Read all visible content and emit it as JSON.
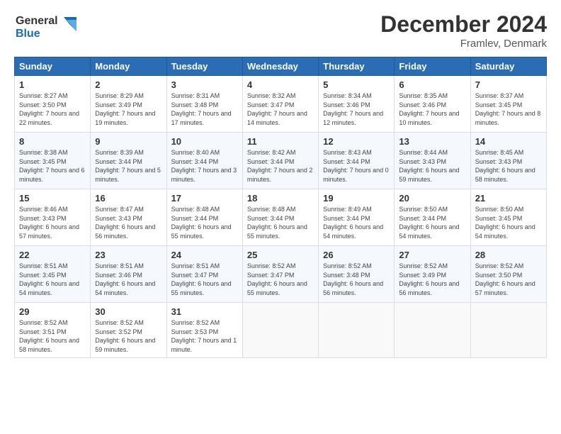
{
  "header": {
    "logo_line1": "General",
    "logo_line2": "Blue",
    "month_title": "December 2024",
    "location": "Framlev, Denmark"
  },
  "weekdays": [
    "Sunday",
    "Monday",
    "Tuesday",
    "Wednesday",
    "Thursday",
    "Friday",
    "Saturday"
  ],
  "weeks": [
    [
      {
        "day": "1",
        "sunrise": "Sunrise: 8:27 AM",
        "sunset": "Sunset: 3:50 PM",
        "daylight": "Daylight: 7 hours and 22 minutes."
      },
      {
        "day": "2",
        "sunrise": "Sunrise: 8:29 AM",
        "sunset": "Sunset: 3:49 PM",
        "daylight": "Daylight: 7 hours and 19 minutes."
      },
      {
        "day": "3",
        "sunrise": "Sunrise: 8:31 AM",
        "sunset": "Sunset: 3:48 PM",
        "daylight": "Daylight: 7 hours and 17 minutes."
      },
      {
        "day": "4",
        "sunrise": "Sunrise: 8:32 AM",
        "sunset": "Sunset: 3:47 PM",
        "daylight": "Daylight: 7 hours and 14 minutes."
      },
      {
        "day": "5",
        "sunrise": "Sunrise: 8:34 AM",
        "sunset": "Sunset: 3:46 PM",
        "daylight": "Daylight: 7 hours and 12 minutes."
      },
      {
        "day": "6",
        "sunrise": "Sunrise: 8:35 AM",
        "sunset": "Sunset: 3:46 PM",
        "daylight": "Daylight: 7 hours and 10 minutes."
      },
      {
        "day": "7",
        "sunrise": "Sunrise: 8:37 AM",
        "sunset": "Sunset: 3:45 PM",
        "daylight": "Daylight: 7 hours and 8 minutes."
      }
    ],
    [
      {
        "day": "8",
        "sunrise": "Sunrise: 8:38 AM",
        "sunset": "Sunset: 3:45 PM",
        "daylight": "Daylight: 7 hours and 6 minutes."
      },
      {
        "day": "9",
        "sunrise": "Sunrise: 8:39 AM",
        "sunset": "Sunset: 3:44 PM",
        "daylight": "Daylight: 7 hours and 5 minutes."
      },
      {
        "day": "10",
        "sunrise": "Sunrise: 8:40 AM",
        "sunset": "Sunset: 3:44 PM",
        "daylight": "Daylight: 7 hours and 3 minutes."
      },
      {
        "day": "11",
        "sunrise": "Sunrise: 8:42 AM",
        "sunset": "Sunset: 3:44 PM",
        "daylight": "Daylight: 7 hours and 2 minutes."
      },
      {
        "day": "12",
        "sunrise": "Sunrise: 8:43 AM",
        "sunset": "Sunset: 3:44 PM",
        "daylight": "Daylight: 7 hours and 0 minutes."
      },
      {
        "day": "13",
        "sunrise": "Sunrise: 8:44 AM",
        "sunset": "Sunset: 3:43 PM",
        "daylight": "Daylight: 6 hours and 59 minutes."
      },
      {
        "day": "14",
        "sunrise": "Sunrise: 8:45 AM",
        "sunset": "Sunset: 3:43 PM",
        "daylight": "Daylight: 6 hours and 58 minutes."
      }
    ],
    [
      {
        "day": "15",
        "sunrise": "Sunrise: 8:46 AM",
        "sunset": "Sunset: 3:43 PM",
        "daylight": "Daylight: 6 hours and 57 minutes."
      },
      {
        "day": "16",
        "sunrise": "Sunrise: 8:47 AM",
        "sunset": "Sunset: 3:43 PM",
        "daylight": "Daylight: 6 hours and 56 minutes."
      },
      {
        "day": "17",
        "sunrise": "Sunrise: 8:48 AM",
        "sunset": "Sunset: 3:44 PM",
        "daylight": "Daylight: 6 hours and 55 minutes."
      },
      {
        "day": "18",
        "sunrise": "Sunrise: 8:48 AM",
        "sunset": "Sunset: 3:44 PM",
        "daylight": "Daylight: 6 hours and 55 minutes."
      },
      {
        "day": "19",
        "sunrise": "Sunrise: 8:49 AM",
        "sunset": "Sunset: 3:44 PM",
        "daylight": "Daylight: 6 hours and 54 minutes."
      },
      {
        "day": "20",
        "sunrise": "Sunrise: 8:50 AM",
        "sunset": "Sunset: 3:44 PM",
        "daylight": "Daylight: 6 hours and 54 minutes."
      },
      {
        "day": "21",
        "sunrise": "Sunrise: 8:50 AM",
        "sunset": "Sunset: 3:45 PM",
        "daylight": "Daylight: 6 hours and 54 minutes."
      }
    ],
    [
      {
        "day": "22",
        "sunrise": "Sunrise: 8:51 AM",
        "sunset": "Sunset: 3:45 PM",
        "daylight": "Daylight: 6 hours and 54 minutes."
      },
      {
        "day": "23",
        "sunrise": "Sunrise: 8:51 AM",
        "sunset": "Sunset: 3:46 PM",
        "daylight": "Daylight: 6 hours and 54 minutes."
      },
      {
        "day": "24",
        "sunrise": "Sunrise: 8:51 AM",
        "sunset": "Sunset: 3:47 PM",
        "daylight": "Daylight: 6 hours and 55 minutes."
      },
      {
        "day": "25",
        "sunrise": "Sunrise: 8:52 AM",
        "sunset": "Sunset: 3:47 PM",
        "daylight": "Daylight: 6 hours and 55 minutes."
      },
      {
        "day": "26",
        "sunrise": "Sunrise: 8:52 AM",
        "sunset": "Sunset: 3:48 PM",
        "daylight": "Daylight: 6 hours and 56 minutes."
      },
      {
        "day": "27",
        "sunrise": "Sunrise: 8:52 AM",
        "sunset": "Sunset: 3:49 PM",
        "daylight": "Daylight: 6 hours and 56 minutes."
      },
      {
        "day": "28",
        "sunrise": "Sunrise: 8:52 AM",
        "sunset": "Sunset: 3:50 PM",
        "daylight": "Daylight: 6 hours and 57 minutes."
      }
    ],
    [
      {
        "day": "29",
        "sunrise": "Sunrise: 8:52 AM",
        "sunset": "Sunset: 3:51 PM",
        "daylight": "Daylight: 6 hours and 58 minutes."
      },
      {
        "day": "30",
        "sunrise": "Sunrise: 8:52 AM",
        "sunset": "Sunset: 3:52 PM",
        "daylight": "Daylight: 6 hours and 59 minutes."
      },
      {
        "day": "31",
        "sunrise": "Sunrise: 8:52 AM",
        "sunset": "Sunset: 3:53 PM",
        "daylight": "Daylight: 7 hours and 1 minute."
      },
      null,
      null,
      null,
      null
    ]
  ]
}
